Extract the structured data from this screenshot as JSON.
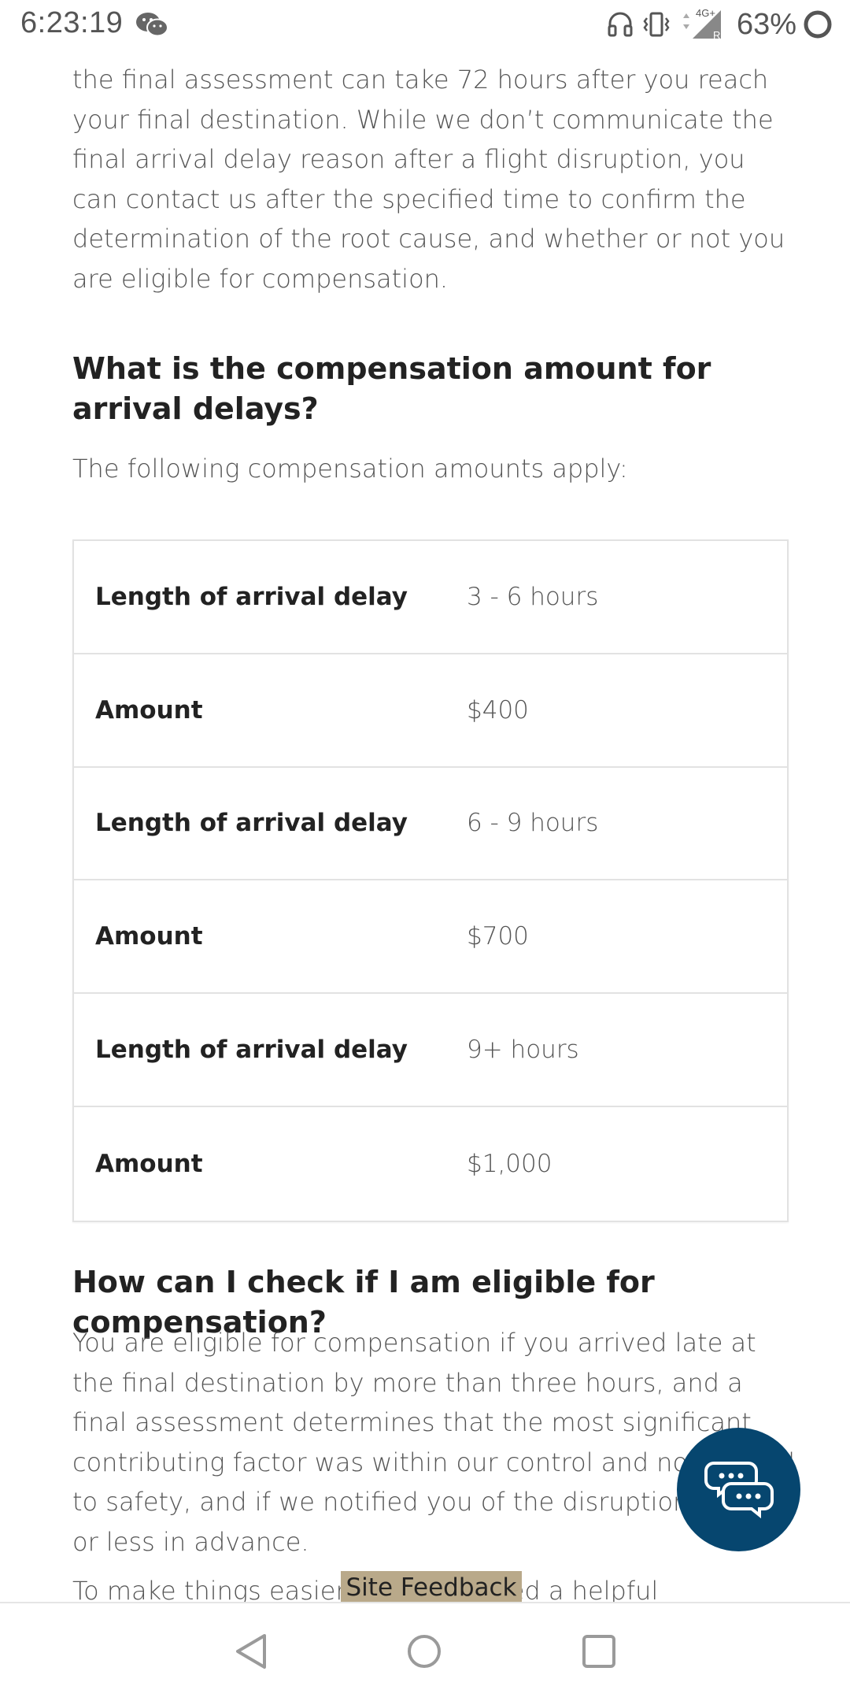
{
  "status_bar": {
    "time": "6:23:19",
    "network": "4G+",
    "network_sub": "R",
    "battery": "63%"
  },
  "article": {
    "top_paragraph": "the final assessment can take 72 hours after you reach your final destination. While we don’t communicate the final arrival delay reason after a flight disruption, you can contact us after the specified time to confirm the determination of the root cause, and whether or not you are eligible for compensation.",
    "heading_amount": "What is the compensation amount for arrival delays?",
    "intro": "The following compensation amounts apply:",
    "table": [
      {
        "label": "Length of arrival delay",
        "value": "3 - 6 hours"
      },
      {
        "label": "Amount",
        "value": "$400"
      },
      {
        "label": "Length of arrival delay",
        "value": "6 - 9 hours"
      },
      {
        "label": "Amount",
        "value": "$700"
      },
      {
        "label": "Length of arrival delay",
        "value": "9+ hours"
      },
      {
        "label": "Amount",
        "value": "$1,000"
      }
    ],
    "heading_eligible": "How can I check if I am eligible for compensation?",
    "eligible_paragraph": "You are eligible for compensation if you arrived late at the final destination by more than three hours, and a final assessment determines that the most significant contributing factor was within our control and not related to safety, and if we notified you of the disruption 14 days or less in advance.",
    "last_paragraph": "To make things easier, we’ve created a helpful"
  },
  "site_feedback": {
    "label": "Site Feedback"
  },
  "chat": {
    "icon": "chat-bubbles-icon"
  },
  "colors": {
    "chat_fab": "#06466f",
    "feedback_tab": "#b9a98a",
    "body_text": "#555555",
    "heading_text": "#222222"
  }
}
